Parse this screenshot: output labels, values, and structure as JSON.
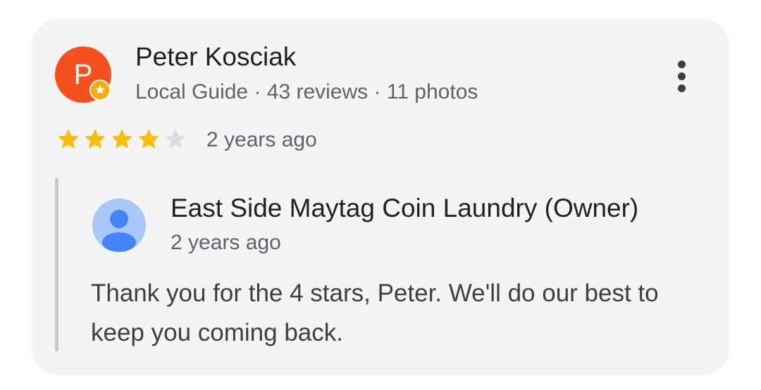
{
  "colors": {
    "avatar_bg": "#f4511e",
    "local_guide_badge": "#f9ab00",
    "star_filled": "#fbbc04",
    "star_empty": "#dadce0",
    "owner_avatar_bg": "#a8c7fa",
    "owner_avatar_fg": "#4285f4"
  },
  "review": {
    "author_initial": "P",
    "author_name": "Peter Kosciak",
    "author_meta": "Local Guide · 43 reviews · 11 photos",
    "rating": 4,
    "rating_max": 5,
    "time_ago": "2 years ago",
    "menu_icon": "more-vert-icon"
  },
  "owner_reply": {
    "name": "East Side Maytag Coin Laundry (Owner)",
    "time_ago": "2 years ago",
    "text": "Thank you for the 4 stars, Peter. We'll do our best to keep you coming back.",
    "avatar_icon": "person-icon"
  }
}
